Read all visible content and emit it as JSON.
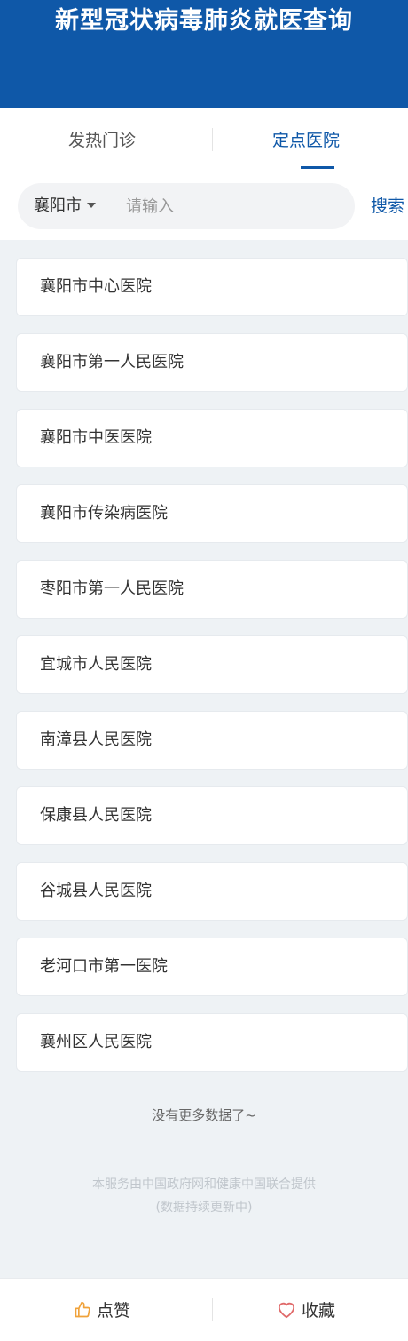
{
  "header": {
    "title": "新型冠状病毒肺炎就医查询"
  },
  "tabs": [
    {
      "label": "发热门诊",
      "active": false
    },
    {
      "label": "定点医院",
      "active": true
    }
  ],
  "search": {
    "city": "襄阳市",
    "placeholder": "请输入",
    "value": "",
    "button_label": "搜索"
  },
  "hospitals": [
    {
      "name": "襄阳市中心医院"
    },
    {
      "name": "襄阳市第一人民医院"
    },
    {
      "name": "襄阳市中医医院"
    },
    {
      "name": "襄阳市传染病医院"
    },
    {
      "name": "枣阳市第一人民医院"
    },
    {
      "name": "宜城市人民医院"
    },
    {
      "name": "南漳县人民医院"
    },
    {
      "name": "保康县人民医院"
    },
    {
      "name": "谷城县人民医院"
    },
    {
      "name": "老河口市第一医院"
    },
    {
      "name": "襄州区人民医院"
    }
  ],
  "list_end_text": "没有更多数据了~",
  "footer": {
    "line1": "本服务由中国政府网和健康中国联合提供",
    "line2": "(数据持续更新中)"
  },
  "bottom_bar": {
    "like_label": "点赞",
    "like_icon": "thumbs-up-icon",
    "favorite_label": "收藏",
    "favorite_icon": "heart-icon"
  },
  "colors": {
    "brand": "#0f58a8",
    "like_icon": "#f0a23a",
    "favorite_icon": "#e06a6a"
  }
}
